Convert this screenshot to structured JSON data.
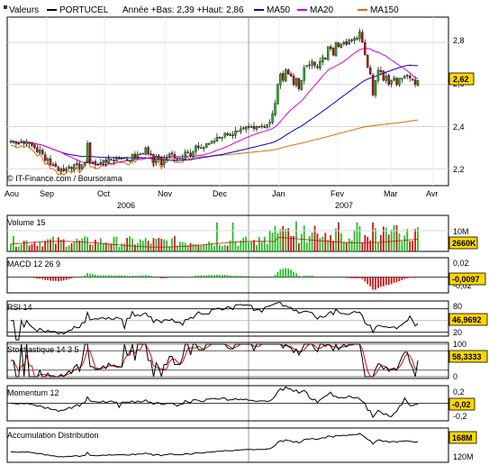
{
  "header": {
    "label": "Valeurs",
    "ticker": "PORTUCEL",
    "range_text": "Année +Bas: 2,39 +Haut: 2,86",
    "ma50_label": "MA50",
    "ma20_label": "MA20",
    "ma150_label": "MA150"
  },
  "colors": {
    "up": "#22bb22",
    "down": "#cc1111",
    "ma20": "#dd00dd",
    "ma50": "#0000cc",
    "ma150": "#e06a10",
    "badge": "#ffd700",
    "grid": "#d9d9d9"
  },
  "footer": {
    "copyright": "© IT-Finance.com / Boursorama"
  },
  "months": [
    "Aou",
    "Sep",
    "Oct",
    "Nov",
    "Dec",
    "Jan",
    "Fev",
    "Mar",
    "Avr"
  ],
  "years": [
    "2006",
    "2007"
  ],
  "chart_data": [
    {
      "type": "candlestick",
      "title": "PORTUCEL",
      "ylim": [
        2.12,
        2.92
      ],
      "yticks": [
        "2,8",
        "2,6",
        "2,4",
        "2,2"
      ],
      "last_value_label": "2,62",
      "close": [
        2.33,
        2.33,
        2.32,
        2.32,
        2.33,
        2.32,
        2.33,
        2.32,
        2.31,
        2.3,
        2.28,
        2.29,
        2.27,
        2.24,
        2.25,
        2.22,
        2.22,
        2.21,
        2.19,
        2.2,
        2.19,
        2.2,
        2.21,
        2.2,
        2.22,
        2.22,
        2.2,
        2.22,
        2.23,
        2.32,
        2.23,
        2.23,
        2.22,
        2.22,
        2.23,
        2.24,
        2.23,
        2.25,
        2.24,
        2.24,
        2.25,
        2.25,
        2.25,
        2.25,
        2.24,
        2.24,
        2.27,
        2.25,
        2.27,
        2.27,
        2.27,
        2.3,
        2.27,
        2.27,
        2.23,
        2.26,
        2.25,
        2.22,
        2.25,
        2.25,
        2.27,
        2.27,
        2.25,
        2.25,
        2.25,
        2.25,
        2.28,
        2.28,
        2.26,
        2.28,
        2.31,
        2.3,
        2.3,
        2.3,
        2.32,
        2.32,
        2.33,
        2.33,
        2.35,
        2.35,
        2.35,
        2.37,
        2.36,
        2.36,
        2.36,
        2.38,
        2.38,
        2.39,
        2.39,
        2.4,
        2.4,
        2.4,
        2.39,
        2.4,
        2.4,
        2.4,
        2.4,
        2.41,
        2.42,
        2.46,
        2.51,
        2.6,
        2.65,
        2.62,
        2.67,
        2.65,
        2.64,
        2.6,
        2.63,
        2.58,
        2.62,
        2.68,
        2.69,
        2.69,
        2.71,
        2.69,
        2.68,
        2.71,
        2.73,
        2.72,
        2.78,
        2.77,
        2.74,
        2.8,
        2.78,
        2.79,
        2.8,
        2.79,
        2.81,
        2.81,
        2.82,
        2.82,
        2.85,
        2.8,
        2.74,
        2.68,
        2.65,
        2.55,
        2.62,
        2.67,
        2.66,
        2.62,
        2.64,
        2.6,
        2.62,
        2.63,
        2.6,
        2.63,
        2.63,
        2.64,
        2.64,
        2.63,
        2.62,
        2.6,
        2.62
      ]
    },
    {
      "type": "bar",
      "title": "Volume 15",
      "yticks": [
        "10M"
      ],
      "last_value_label": "2660K"
    },
    {
      "type": "bar",
      "title": "MACD 12 26 9",
      "yticks": [
        "0,02",
        "0",
        "-0,02"
      ],
      "last_value_label": "-0,0097"
    },
    {
      "type": "line",
      "title": "RSI 14",
      "yticks": [
        "80",
        "50",
        "20"
      ],
      "last_value_label": "46,9692"
    },
    {
      "type": "line",
      "title": "Stochastique 14 3 5",
      "yticks": [
        "100",
        "50",
        "0"
      ],
      "last_value_label": "58,3333"
    },
    {
      "type": "line",
      "title": "Momentum 12",
      "yticks": [
        "0,2",
        "0",
        "-0,2"
      ],
      "last_value_label": "-0,02"
    },
    {
      "type": "line",
      "title": "Accumulation Distribution",
      "yticks": [
        "160M",
        "120M"
      ],
      "last_value_label": "168M"
    }
  ]
}
